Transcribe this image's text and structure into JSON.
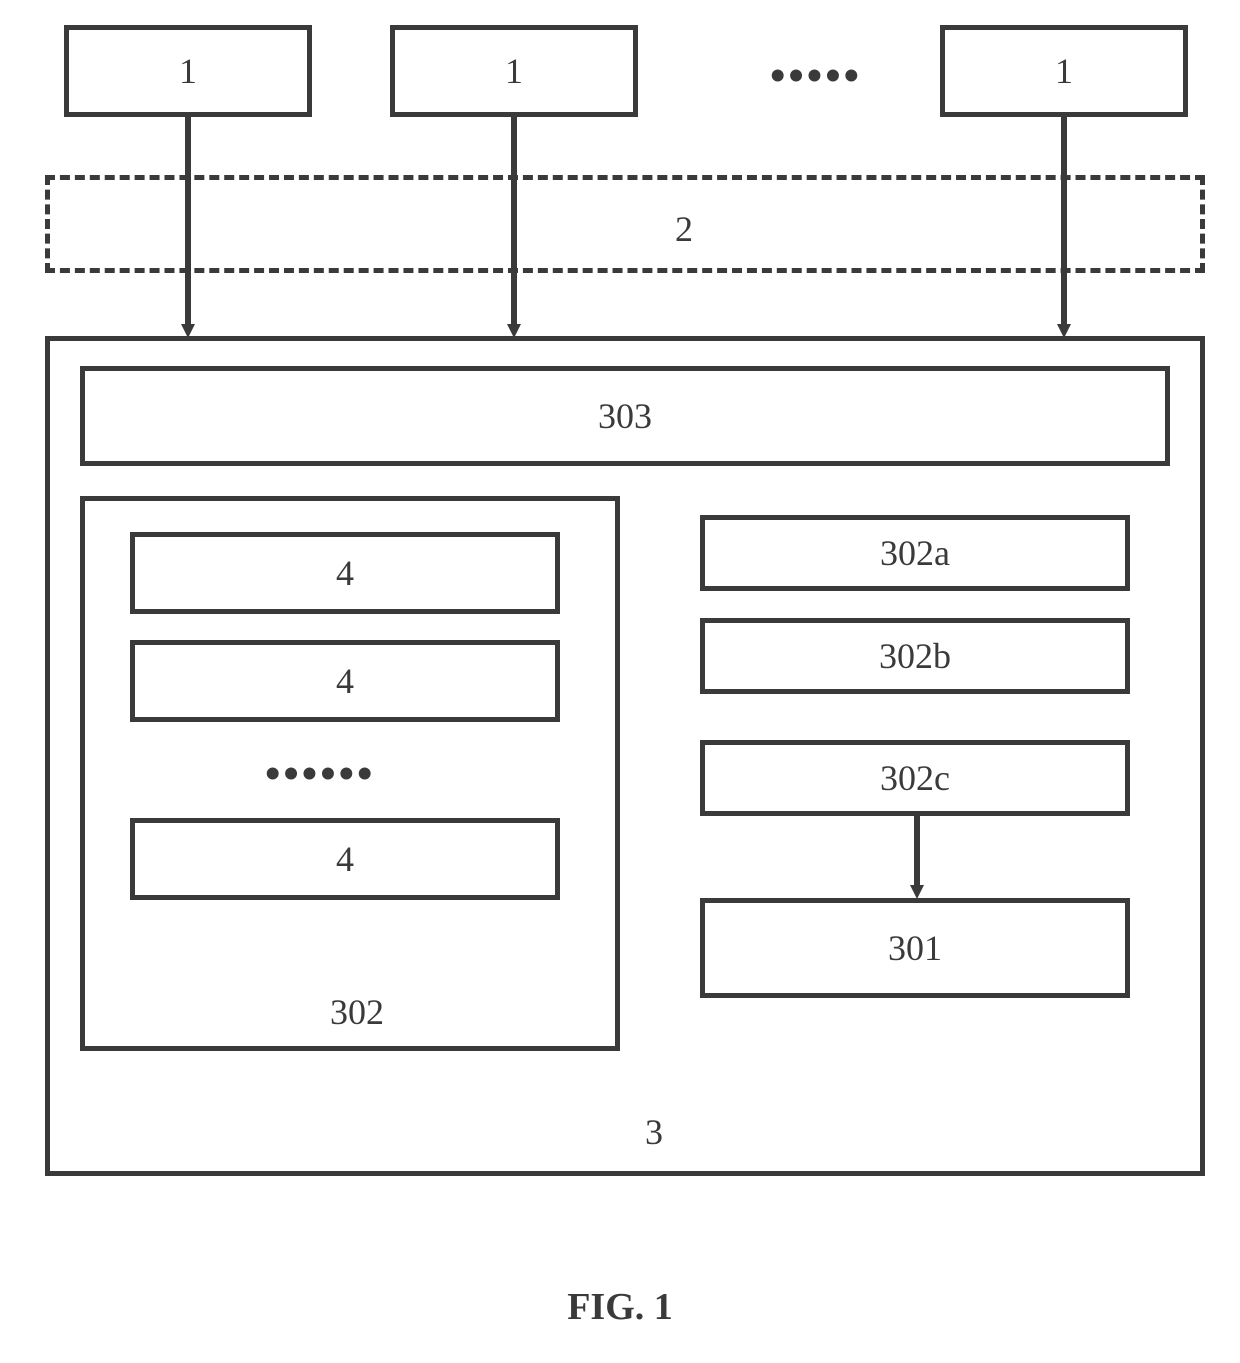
{
  "top_boxes": [
    "1",
    "1",
    "1"
  ],
  "top_ellipsis": "•••••",
  "middle_dashed_label": "2",
  "main_container_label": "3",
  "wide_box_label": "303",
  "left_region": {
    "items": [
      "4",
      "4",
      "4"
    ],
    "ellipsis": "••••••",
    "region_label": "302"
  },
  "right_region": {
    "items": [
      "302a",
      "302b",
      "302c"
    ],
    "bottom_box": "301"
  },
  "caption": "FIG. 1"
}
